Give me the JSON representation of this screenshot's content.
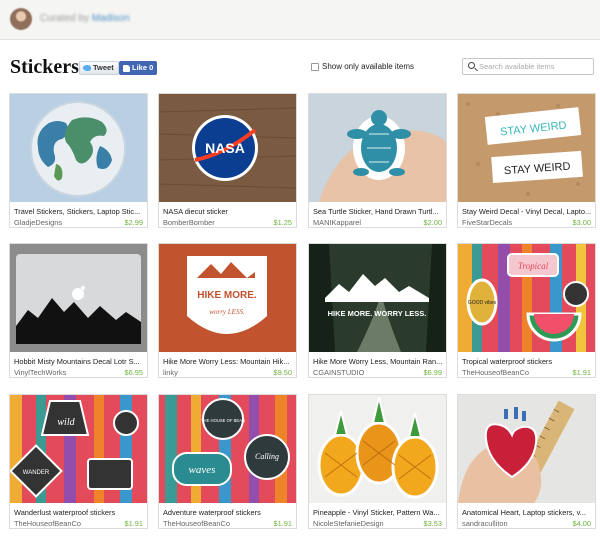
{
  "header": {
    "curated_prefix": "Curated by",
    "curator": "Madison"
  },
  "page": {
    "title": "Stickers"
  },
  "social": {
    "tweet": "Tweet",
    "like": "Like 0"
  },
  "filters": {
    "available_label": "Show only available items",
    "available_checked": false
  },
  "search": {
    "placeholder": "Search available items",
    "value": ""
  },
  "colors": {
    "price": "#6db33f",
    "link": "#4a90c8",
    "facebook": "#4267b2"
  },
  "items": [
    {
      "title": "Travel Stickers, Stickers, Laptop Stic...",
      "shop": "GladjeDesigns",
      "price": "$2.99"
    },
    {
      "title": "NASA diecut sticker",
      "shop": "BomberBomber",
      "price": "$1.25"
    },
    {
      "title": "Sea Turtle Sticker, Hand Drawn Turtl...",
      "shop": "MANIKapparel",
      "price": "$2.00"
    },
    {
      "title": "Stay Weird Decal - Vinyl Decal, Lapto...",
      "shop": "FiveStarDecals",
      "price": "$3.00"
    },
    {
      "title": "Hobbit Misty Mountains Decal Lotr S...",
      "shop": "VinylTechWorks",
      "price": "$6.95"
    },
    {
      "title": "Hike More Worry Less: Mountain Hik...",
      "shop": "linky",
      "price": "$9.50"
    },
    {
      "title": "Hike More Worry Less, Mountain Ran...",
      "shop": "CGAINSTUDIO",
      "price": "$6.99"
    },
    {
      "title": "Tropical waterproof stickers",
      "shop": "TheHouseofBeanCo",
      "price": "$1.91"
    },
    {
      "title": "Wanderlust waterproof stickers",
      "shop": "TheHouseofBeanCo",
      "price": "$1.91"
    },
    {
      "title": "Adventure waterproof stickers",
      "shop": "TheHouseofBeanCo",
      "price": "$1.91"
    },
    {
      "title": "Pineapple - Vinyl Sticker, Pattern Wa...",
      "shop": "NicoleStefanieDesign",
      "price": "$3.53"
    },
    {
      "title": "Anatomical Heart, Laptop stickers, v...",
      "shop": "sandraculliton",
      "price": "$4.00"
    }
  ],
  "artwork": {
    "nasa": "NASA",
    "stay_weird": "STAY WEIRD",
    "hike_more": "HIKE MORE.",
    "worry_less": "worry LESS.",
    "hike_more_worry_less": "HIKE MORE. WORRY LESS.",
    "good_vibes": "GOOD vibes",
    "tropical": "Tropical",
    "wild": "wild",
    "wander": "WANDER",
    "house_of_bean": "THE HOUSE OF BEAN",
    "calling": "Calling",
    "waves": "waves"
  }
}
